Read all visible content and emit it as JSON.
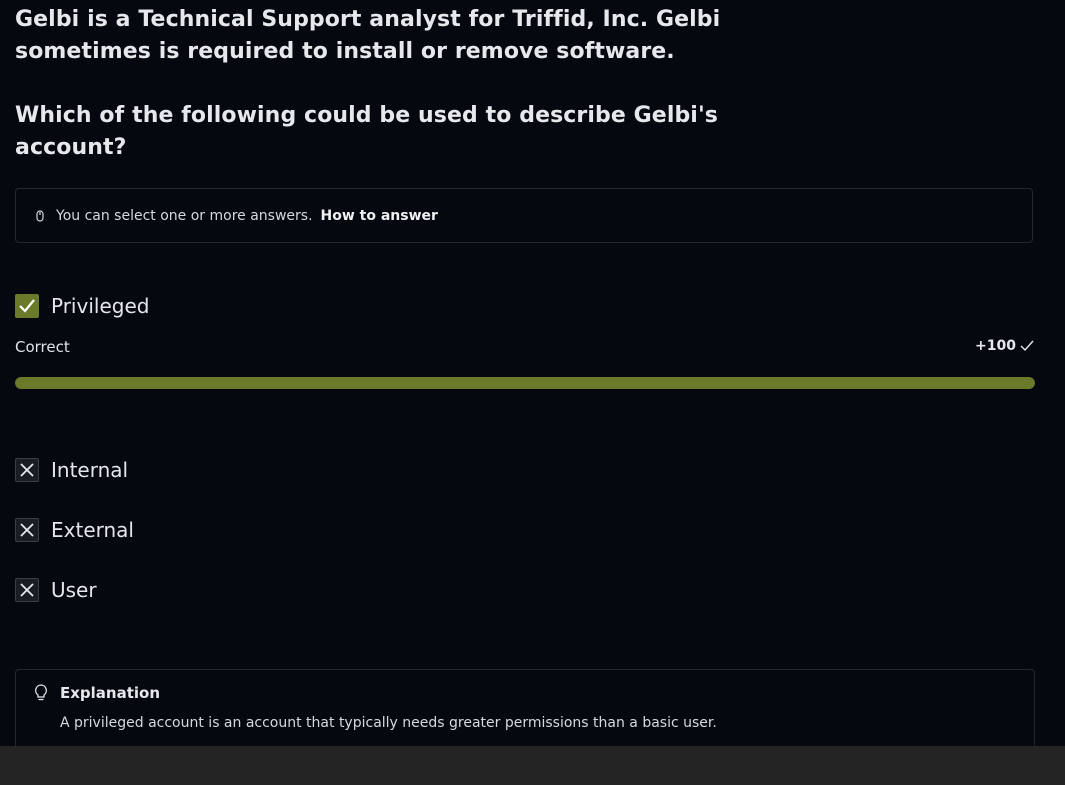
{
  "question": {
    "paragraph1": "Gelbi is a Technical Support analyst for Triffid, Inc. Gelbi sometimes is required to install or remove software.",
    "paragraph2": "Which of the following could be used to describe Gelbi's account?"
  },
  "hint": {
    "icon": "hint-icon",
    "text": "You can select one or more answers.",
    "link_label": "How to answer"
  },
  "options": [
    {
      "label": "Privileged",
      "state": "checked-correct"
    },
    {
      "label": "Internal",
      "state": "not-selected"
    },
    {
      "label": "External",
      "state": "not-selected"
    },
    {
      "label": "User",
      "state": "not-selected"
    }
  ],
  "result": {
    "status": "Correct",
    "score": "+100",
    "progress_percent": 100
  },
  "explanation": {
    "icon": "lightbulb-icon",
    "title": "Explanation",
    "text": "A privileged account is an account that typically needs greater permissions than a basic user."
  },
  "colors": {
    "background": "#05090f",
    "accent_green": "#6b7a2a",
    "text": "#e6e8ec"
  }
}
